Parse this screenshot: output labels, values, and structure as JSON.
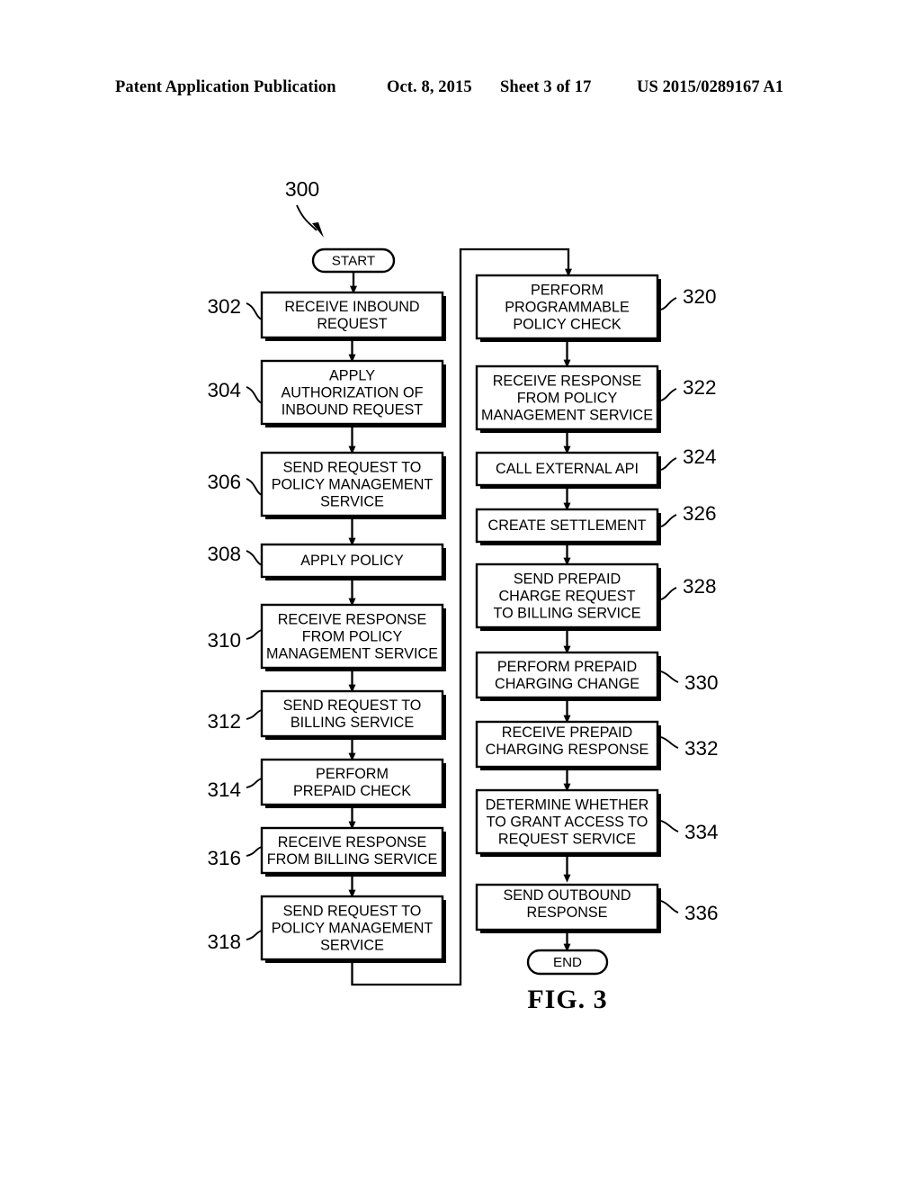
{
  "page_header": {
    "publication": "Patent Application Publication",
    "date": "Oct. 8, 2015",
    "sheet": "Sheet 3 of 17",
    "patent_number": "US 2015/0289167 A1"
  },
  "figure": {
    "caption": "FIG. 3",
    "diagram_number": "300",
    "start_label": "START",
    "end_label": "END"
  },
  "flow": {
    "left_column": [
      {
        "ref": "302",
        "text": [
          "RECEIVE INBOUND",
          "REQUEST"
        ]
      },
      {
        "ref": "304",
        "text": [
          "APPLY",
          "AUTHORIZATION OF",
          "INBOUND REQUEST"
        ]
      },
      {
        "ref": "306",
        "text": [
          "SEND REQUEST TO",
          "POLICY MANAGEMENT",
          "SERVICE"
        ]
      },
      {
        "ref": "308",
        "text": [
          "APPLY POLICY"
        ]
      },
      {
        "ref": "310",
        "text": [
          "RECEIVE RESPONSE",
          "FROM POLICY",
          "MANAGEMENT SERVICE"
        ]
      },
      {
        "ref": "312",
        "text": [
          "SEND REQUEST TO",
          "BILLING SERVICE"
        ]
      },
      {
        "ref": "314",
        "text": [
          "PERFORM",
          "PREPAID CHECK"
        ]
      },
      {
        "ref": "316",
        "text": [
          "RECEIVE RESPONSE",
          "FROM BILLING SERVICE"
        ]
      },
      {
        "ref": "318",
        "text": [
          "SEND REQUEST TO",
          "POLICY MANAGEMENT",
          "SERVICE"
        ]
      }
    ],
    "right_column": [
      {
        "ref": "320",
        "text": [
          "PERFORM",
          "PROGRAMMABLE",
          "POLICY CHECK"
        ]
      },
      {
        "ref": "322",
        "text": [
          "RECEIVE RESPONSE",
          "FROM POLICY",
          "MANAGEMENT SERVICE"
        ]
      },
      {
        "ref": "324",
        "text": [
          "CALL EXTERNAL API"
        ]
      },
      {
        "ref": "326",
        "text": [
          "CREATE SETTLEMENT"
        ]
      },
      {
        "ref": "328",
        "text": [
          "SEND PREPAID",
          "CHARGE REQUEST",
          "TO BILLING SERVICE"
        ]
      },
      {
        "ref": "330",
        "text": [
          "PERFORM PREPAID",
          "CHARGING CHANGE"
        ]
      },
      {
        "ref": "332",
        "text": [
          "RECEIVE PREPAID",
          "CHARGING RESPONSE"
        ]
      },
      {
        "ref": "334",
        "text": [
          "DETERMINE WHETHER",
          "TO GRANT ACCESS TO",
          "REQUEST SERVICE"
        ]
      },
      {
        "ref": "336",
        "text": [
          "SEND OUTBOUND",
          "RESPONSE"
        ]
      }
    ]
  },
  "colors": {
    "ink": "#000000",
    "paper": "#ffffff"
  }
}
